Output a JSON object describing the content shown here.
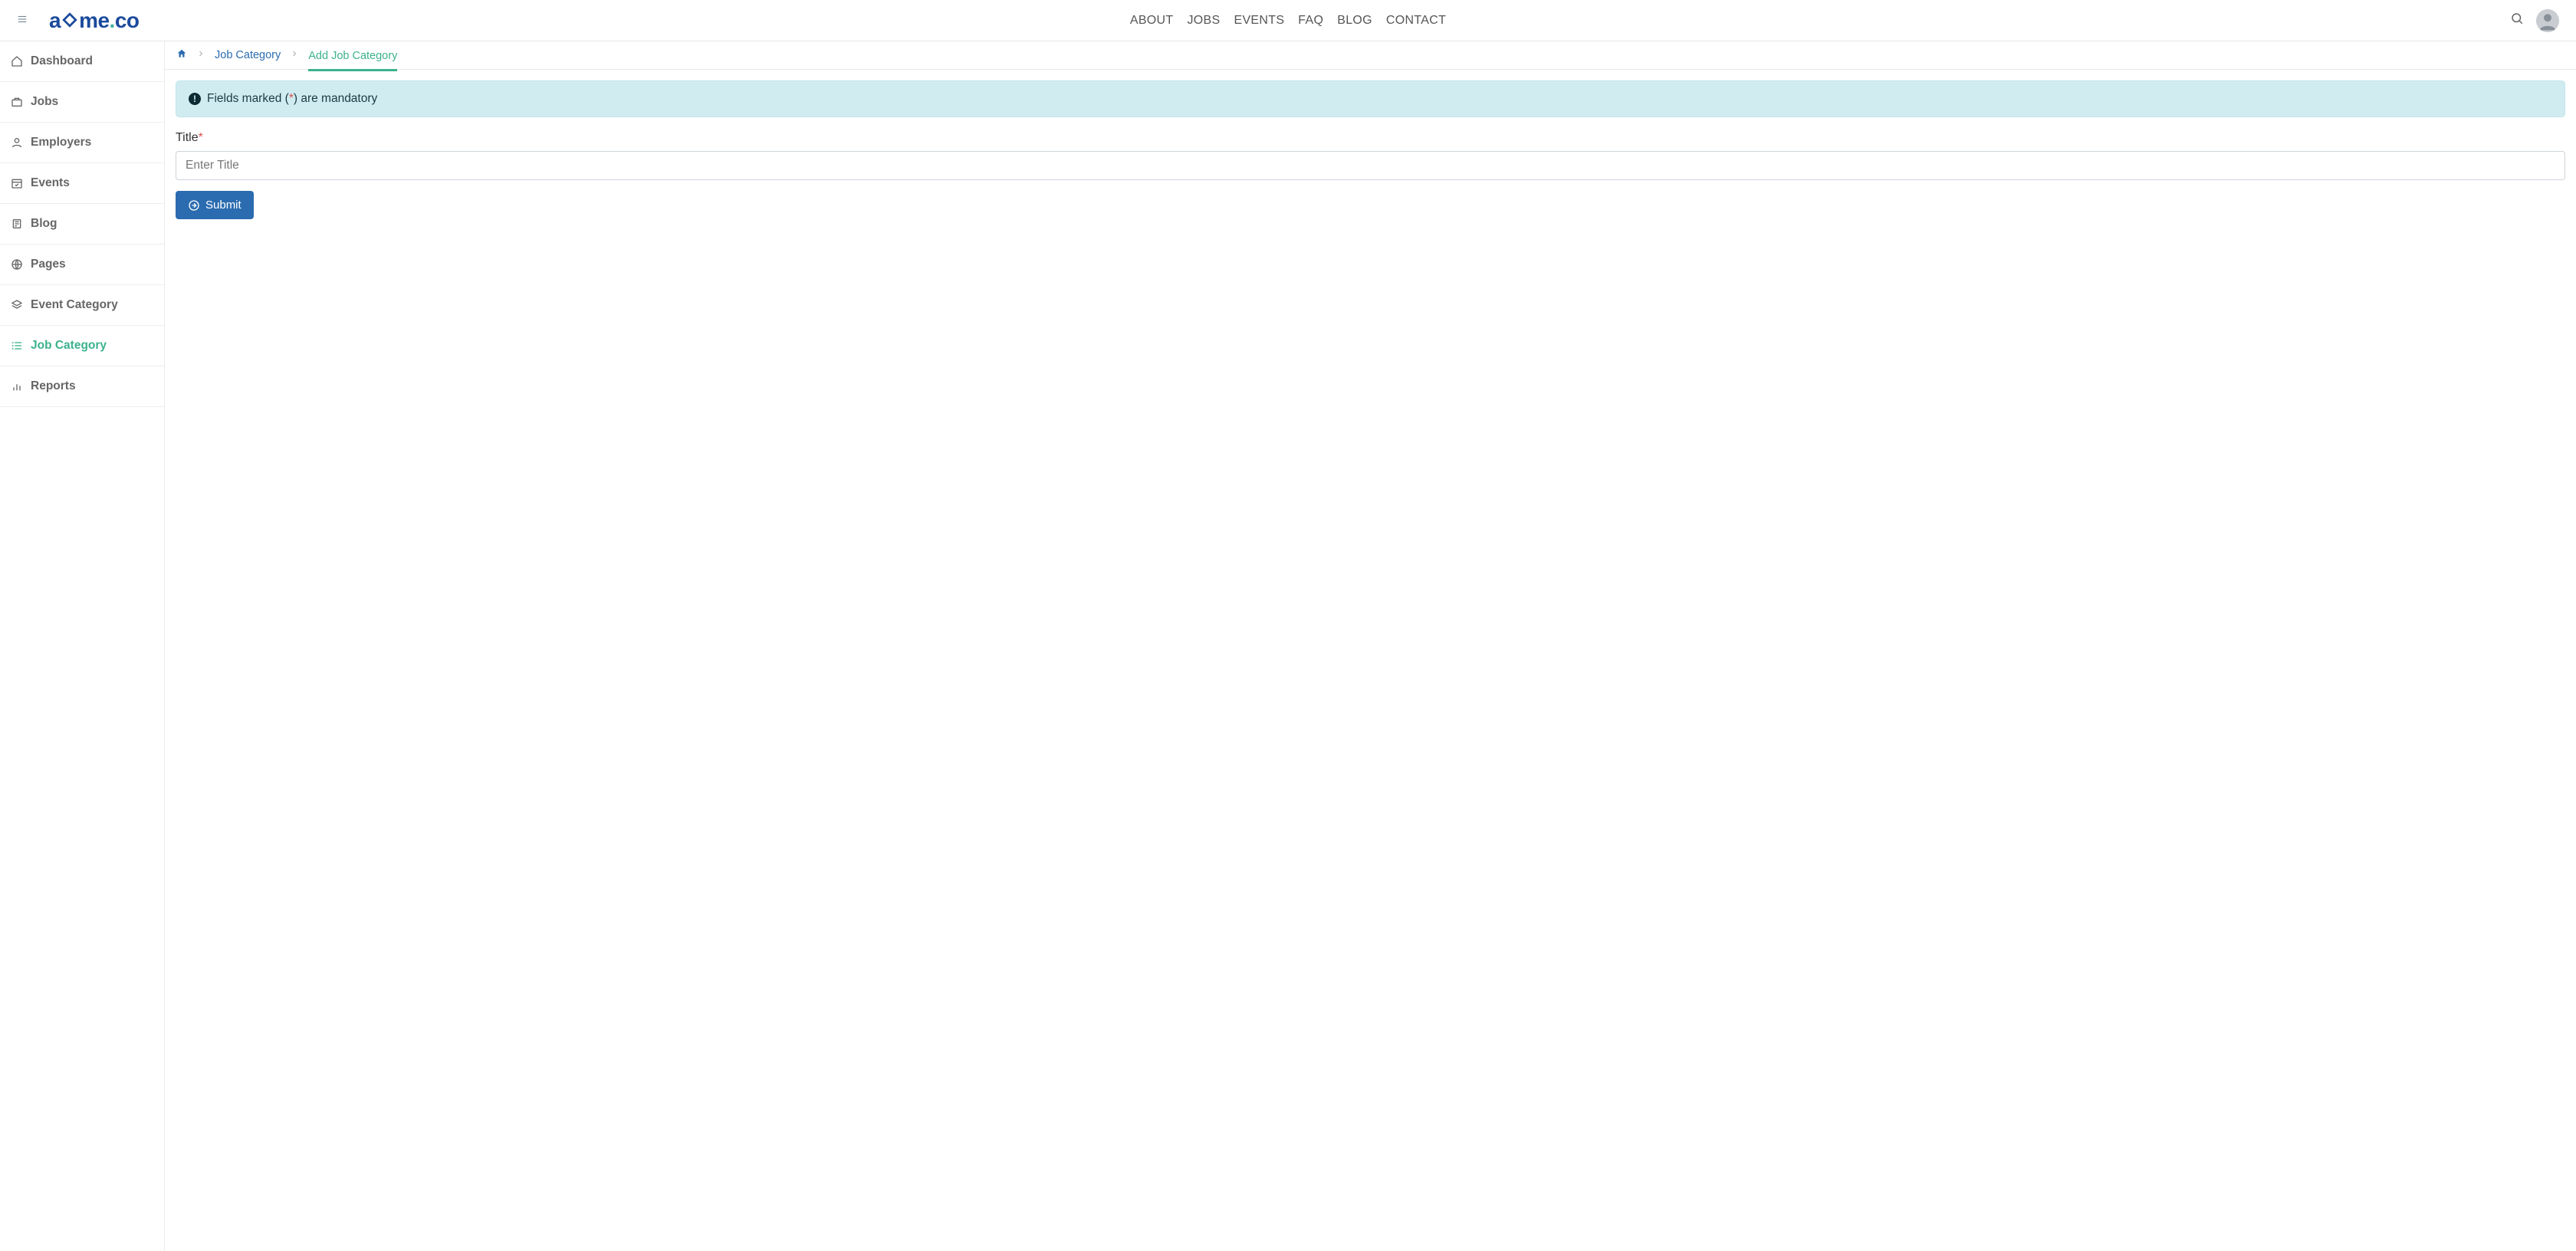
{
  "brand": {
    "prefix": "a",
    "suffix": "me",
    "tld": "co"
  },
  "topNav": [
    {
      "label": "ABOUT"
    },
    {
      "label": "JOBS"
    },
    {
      "label": "EVENTS"
    },
    {
      "label": "FAQ"
    },
    {
      "label": "BLOG"
    },
    {
      "label": "CONTACT"
    }
  ],
  "sidebar": [
    {
      "label": "Dashboard",
      "icon": "home",
      "active": false
    },
    {
      "label": "Jobs",
      "icon": "briefcase",
      "active": false
    },
    {
      "label": "Employers",
      "icon": "user",
      "active": false
    },
    {
      "label": "Events",
      "icon": "calendar-check",
      "active": false
    },
    {
      "label": "Blog",
      "icon": "book",
      "active": false
    },
    {
      "label": "Pages",
      "icon": "globe",
      "active": false
    },
    {
      "label": "Event Category",
      "icon": "layers",
      "active": false
    },
    {
      "label": "Job Category",
      "icon": "list",
      "active": true
    },
    {
      "label": "Reports",
      "icon": "bar-chart",
      "active": false
    }
  ],
  "breadcrumb": {
    "link": "Job Category",
    "current": "Add Job Category"
  },
  "alert": {
    "prefix": "Fields marked (",
    "star": "*",
    "suffix": ") are mandatory"
  },
  "form": {
    "titleLabel": "Title",
    "titlePlaceholder": "Enter Title",
    "submitLabel": "Submit"
  }
}
